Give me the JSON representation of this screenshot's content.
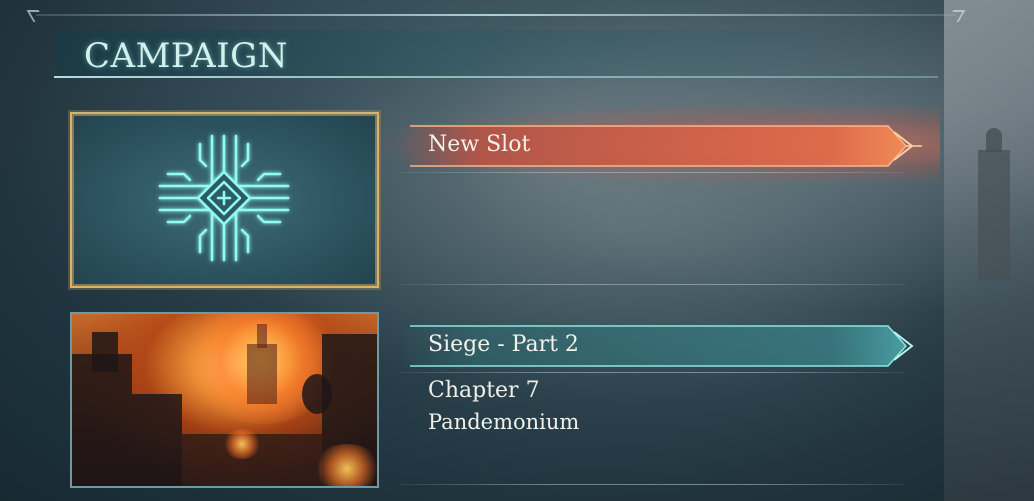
{
  "header": {
    "title": "CAMPAIGN"
  },
  "slots": [
    {
      "banner_label": "New Slot",
      "icon": "new-slot-plus-circuit-icon",
      "selected": true,
      "accent_color": "#e0714e"
    },
    {
      "banner_label": "Siege - Part 2",
      "chapter": "Chapter 7",
      "location": "Pandemonium",
      "selected": false,
      "accent_color": "#5fc8c6"
    }
  ],
  "colors": {
    "selected_border": "#d8b46a",
    "icon_glow": "#6ff5e6",
    "text": "#f4f1ea"
  }
}
